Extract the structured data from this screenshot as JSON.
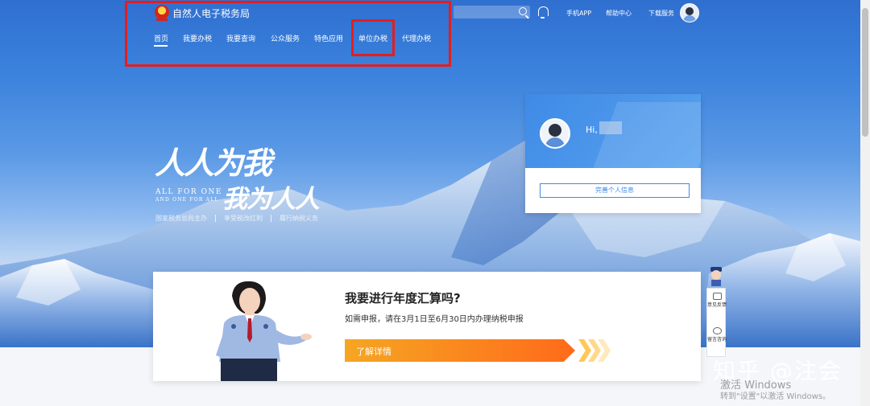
{
  "header": {
    "site_title": "自然人电子税务局",
    "links": {
      "mobile_app": "手机APP",
      "help_center": "帮助中心",
      "download_service": "下载服务"
    }
  },
  "nav": {
    "items": [
      "首页",
      "我要办税",
      "我要查询",
      "公众服务",
      "特色应用",
      "单位办税",
      "代理办税"
    ],
    "active_index": 0,
    "highlighted_item": "单位办税"
  },
  "hero": {
    "slogan_line1": "人人为我",
    "slogan_line2": "我为人人",
    "slogan_en_line1": "ALL FOR ONE",
    "slogan_en_line2": "AND ONE FOR ALL",
    "tags": [
      "国家税务总局主办",
      "享受税改红利",
      "履行纳税义务"
    ]
  },
  "user_card": {
    "greeting": "Hi,",
    "complete_info_button": "完善个人信息"
  },
  "promo": {
    "title": "我要进行年度汇算吗?",
    "description": "如需申报，请在3月1日至6月30日内办理纳税申报",
    "button": "了解详情"
  },
  "side_float": {
    "feedback": "意见反馈",
    "message": "留言咨询"
  },
  "watermark": {
    "zhihu": "知乎 @注会",
    "activate_1": "激活 Windows",
    "activate_2": "转到\"设置\"以激活 Windows。"
  },
  "colors": {
    "highlight_red": "#e51d1d",
    "primary_blue": "#3e8ae6",
    "button_orange": "#ff6a1a"
  }
}
